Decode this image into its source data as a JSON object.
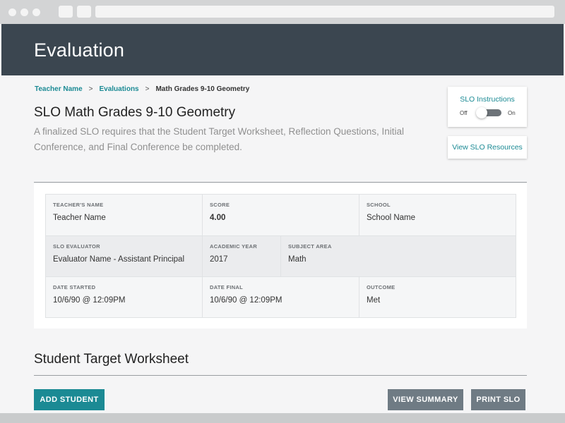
{
  "header": {
    "title": "Evaluation"
  },
  "breadcrumb": {
    "items": [
      "Teacher Name",
      "Evaluations",
      "Math Grades 9-10 Geometry"
    ],
    "separator": ">"
  },
  "page": {
    "title": "SLO Math Grades 9-10 Geometry",
    "description": "A finalized SLO requires that the Student Target Worksheet, Reflection Questions, Initial Conference, and Final Conference be completed."
  },
  "instructions": {
    "title": "SLO Instructions",
    "off_label": "Off",
    "on_label": "On",
    "toggle_state": "off"
  },
  "resources": {
    "label": "View SLO Resources"
  },
  "info": {
    "teacher_name": {
      "label": "TEACHER'S NAME",
      "value": "Teacher Name"
    },
    "score": {
      "label": "SCORE",
      "value": "4.00"
    },
    "school": {
      "label": "SCHOOL",
      "value": "School Name"
    },
    "evaluator": {
      "label": "SLO EVALUATOR",
      "value": "Evaluator Name - Assistant Principal"
    },
    "academic_year": {
      "label": "ACADEMIC YEAR",
      "value": "2017"
    },
    "subject_area": {
      "label": "SUBJECT AREA",
      "value": "Math"
    },
    "date_started": {
      "label": "DATE STARTED",
      "value": "10/6/90 @ 12:09PM"
    },
    "date_final": {
      "label": "DATE FINAL",
      "value": "10/6/90 @ 12:09PM"
    },
    "outcome": {
      "label": "OUTCOME",
      "value": "Met"
    }
  },
  "worksheet": {
    "title": "Student Target Worksheet",
    "add_student_label": "ADD STUDENT",
    "view_summary_label": "VIEW SUMMARY",
    "print_label": "PRINT SLO"
  },
  "colors": {
    "header_bg": "#3b4650",
    "accent": "#1b8a94",
    "button_secondary": "#6f7b84",
    "page_bg": "#f5f5f6"
  }
}
